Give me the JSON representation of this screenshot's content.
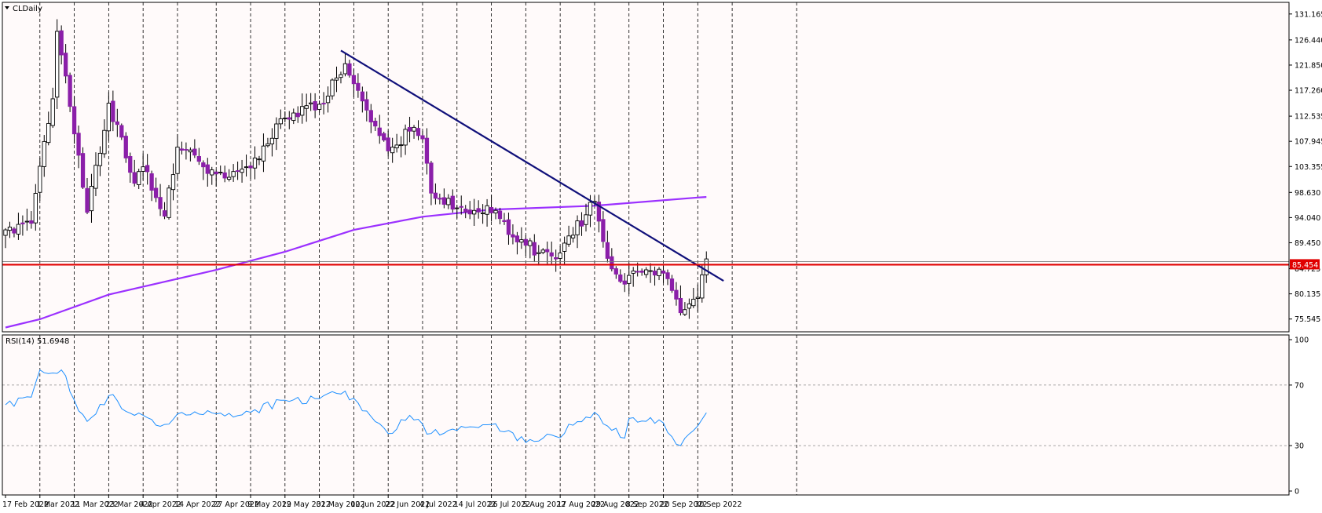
{
  "chart_title": "CLDaily",
  "rsi_label": "RSI(14) 51.6948",
  "current_price_tag": "85.454",
  "colors": {
    "background": "#fffafa",
    "up_candle_body": "#ffffff",
    "down_candle_body": "#8b1fa9",
    "candle_outline": "#000000",
    "sma_line": "#9b30ff",
    "trend_line": "#10107a",
    "horizontal_level": "#e00000",
    "rsi_line": "#1e90ff",
    "grid": "#000000"
  },
  "chart_data": [
    {
      "type": "candlestick",
      "title": "CLDaily",
      "ylim": [
        73.5,
        133.0
      ],
      "y_ticks": [
        "131.165",
        "126.440",
        "121.850",
        "117.260",
        "112.535",
        "107.945",
        "103.355",
        "98.630",
        "94.040",
        "89.450",
        "84.725",
        "80.135",
        "75.545"
      ],
      "x_ticks": [
        "17 Feb 2022",
        "1 Mar 2022",
        "11 Mar 2022",
        "23 Mar 2022",
        "4 Apr 2022",
        "14 Apr 2022",
        "27 Apr 2022",
        "9 May 2022",
        "19 May 2022",
        "31 May 2022",
        "10 Jun 2022",
        "22 Jun 2022",
        "4 Jul 2022",
        "14 Jul 2022",
        "26 Jul 2022",
        "5 Aug 2022",
        "17 Aug 2022",
        "29 Aug 2022",
        "8 Sep 2022",
        "20 Sep 2022",
        "30 Sep 2022"
      ],
      "price_anchors": [
        [
          "17 Feb 2022",
          91.8
        ],
        [
          "25 Feb 2022",
          93.0
        ],
        [
          "1 Mar 2022",
          103.4
        ],
        [
          "4 Mar 2022",
          115.7
        ],
        [
          "7 Mar 2022",
          128.0
        ],
        [
          "8 Mar 2022",
          123.7
        ],
        [
          "11 Mar 2022",
          109.3
        ],
        [
          "16 Mar 2022",
          95.0
        ],
        [
          "23 Mar 2022",
          114.9
        ],
        [
          "31 Mar 2022",
          100.3
        ],
        [
          "4 Apr 2022",
          103.3
        ],
        [
          "11 Apr 2022",
          94.3
        ],
        [
          "14 Apr 2022",
          106.9
        ],
        [
          "27 Apr 2022",
          102.0
        ],
        [
          "9 May 2022",
          103.1
        ],
        [
          "19 May 2022",
          112.2
        ],
        [
          "31 May 2022",
          114.7
        ],
        [
          "8 Jun 2022",
          122.1
        ],
        [
          "14 Jun 2022",
          115.3
        ],
        [
          "22 Jun 2022",
          106.2
        ],
        [
          "29 Jun 2022",
          109.8
        ],
        [
          "4 Jul 2022",
          108.4
        ],
        [
          "6 Jul 2022",
          98.5
        ],
        [
          "14 Jul 2022",
          95.8
        ],
        [
          "26 Jul 2022",
          94.9
        ],
        [
          "5 Aug 2022",
          89.0
        ],
        [
          "16 Aug 2022",
          86.5
        ],
        [
          "29 Aug 2022",
          97.0
        ],
        [
          "1 Sep 2022",
          86.6
        ],
        [
          "7 Sep 2022",
          81.9
        ],
        [
          "8 Sep 2022",
          83.5
        ],
        [
          "20 Sep 2022",
          83.9
        ],
        [
          "26 Sep 2022",
          76.7
        ],
        [
          "30 Sep 2022",
          79.5
        ],
        [
          "3 Oct 2022",
          83.6
        ],
        [
          "4 Oct 2022",
          86.5
        ]
      ],
      "moving_average": [
        [
          "17 Feb 2022",
          74.0
        ],
        [
          "1 Mar 2022",
          75.5
        ],
        [
          "23 Mar 2022",
          80.0
        ],
        [
          "27 Apr 2022",
          84.5
        ],
        [
          "19 May 2022",
          87.8
        ],
        [
          "10 Jun 2022",
          91.8
        ],
        [
          "4 Jul 2022",
          94.2
        ],
        [
          "26 Jul 2022",
          95.5
        ],
        [
          "29 Aug 2022",
          96.2
        ],
        [
          "30 Sep 2022",
          97.7
        ],
        [
          "4 Oct 2022",
          97.8
        ]
      ],
      "trend_line": [
        [
          "7 Jun 2022",
          124.5
        ],
        [
          "10 Oct 2022",
          82.5
        ]
      ],
      "horizontal_level": 85.454
    },
    {
      "type": "line",
      "title": "RSI(14) 51.6948",
      "ylim": [
        0,
        100
      ],
      "y_ticks": [
        "100",
        "70",
        "30",
        "0"
      ],
      "levels": [
        70,
        30
      ],
      "last_value": 51.6948,
      "values_anchors": [
        [
          "17 Feb 2022",
          57
        ],
        [
          "25 Feb 2022",
          62
        ],
        [
          "1 Mar 2022",
          80
        ],
        [
          "4 Mar 2022",
          78
        ],
        [
          "8 Mar 2022",
          80
        ],
        [
          "11 Mar 2022",
          60
        ],
        [
          "16 Mar 2022",
          46
        ],
        [
          "23 Mar 2022",
          63
        ],
        [
          "31 Mar 2022",
          50
        ],
        [
          "11 Apr 2022",
          44
        ],
        [
          "14 Apr 2022",
          51
        ],
        [
          "27 Apr 2022",
          51
        ],
        [
          "9 May 2022",
          52
        ],
        [
          "19 May 2022",
          60
        ],
        [
          "31 May 2022",
          61
        ],
        [
          "8 Jun 2022",
          66
        ],
        [
          "14 Jun 2022",
          53
        ],
        [
          "22 Jun 2022",
          38
        ],
        [
          "29 Jun 2022",
          50
        ],
        [
          "6 Jul 2022",
          38
        ],
        [
          "14 Jul 2022",
          40
        ],
        [
          "26 Jul 2022",
          44
        ],
        [
          "5 Aug 2022",
          32
        ],
        [
          "16 Aug 2022",
          36
        ],
        [
          "29 Aug 2022",
          52
        ],
        [
          "1 Sep 2022",
          43
        ],
        [
          "7 Sep 2022",
          35
        ],
        [
          "8 Sep 2022",
          48
        ],
        [
          "20 Sep 2022",
          45
        ],
        [
          "26 Sep 2022",
          30
        ],
        [
          "30 Sep 2022",
          43
        ],
        [
          "4 Oct 2022",
          51.7
        ]
      ]
    }
  ]
}
